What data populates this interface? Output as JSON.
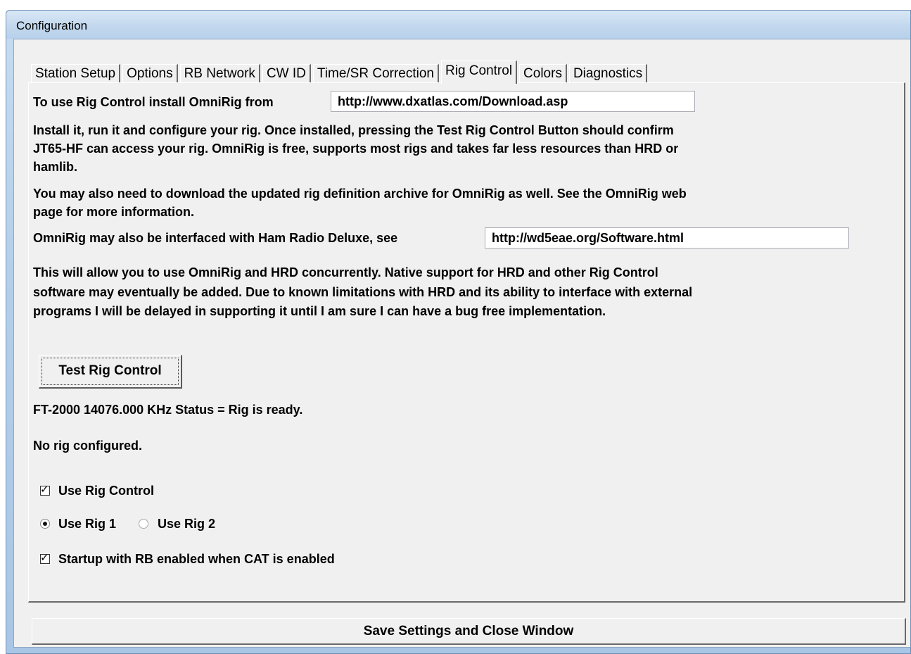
{
  "window": {
    "title": "Configuration"
  },
  "tabs": [
    {
      "label": "Station Setup"
    },
    {
      "label": "Options"
    },
    {
      "label": "RB Network"
    },
    {
      "label": "CW ID"
    },
    {
      "label": "Time/SR Correction"
    },
    {
      "label": "Rig Control",
      "active": true
    },
    {
      "label": "Colors"
    },
    {
      "label": "Diagnostics"
    }
  ],
  "rig_control": {
    "install_label": "To use Rig Control install OmniRig from",
    "omnirig_url": "http://www.dxatlas.com/Download.asp",
    "install_text": "Install it, run it and configure your rig.  Once installed, pressing the Test Rig Control Button should confirm JT65-HF can access your rig. OmniRig is free, supports most rigs and takes far less resources than HRD or hamlib.",
    "update_text": "You may also need to download the updated rig definition archive for OmniRig as well.  See the OmniRig web page for more information.",
    "hrd_label": "OmniRig may also be interfaced with Ham Radio Deluxe, see",
    "hrd_url": "http://wd5eae.org/Software.html",
    "concurrent_text": "This will allow you to use OmniRig and HRD concurrently.  Native support for HRD and other Rig Control software may eventually be added.  Due to known limitations with HRD and its ability to interface with external programs I will be delayed in supporting it until I am sure I can have a bug free implementation.",
    "test_button": "Test Rig Control",
    "status_rig1": "FT-2000  14076.000 KHz  Status = Rig is ready.",
    "status_rig2": "No rig configured.",
    "use_rig_control": {
      "label": "Use Rig Control",
      "checked": true
    },
    "use_rig_1": {
      "label": "Use Rig 1",
      "selected": true
    },
    "use_rig_2": {
      "label": "Use Rig 2",
      "selected": false
    },
    "startup_rb": {
      "label": "Startup with RB enabled when CAT is enabled",
      "checked": true
    },
    "check_mark": "✓"
  },
  "footer": {
    "save_button": "Save Settings and Close Window"
  }
}
